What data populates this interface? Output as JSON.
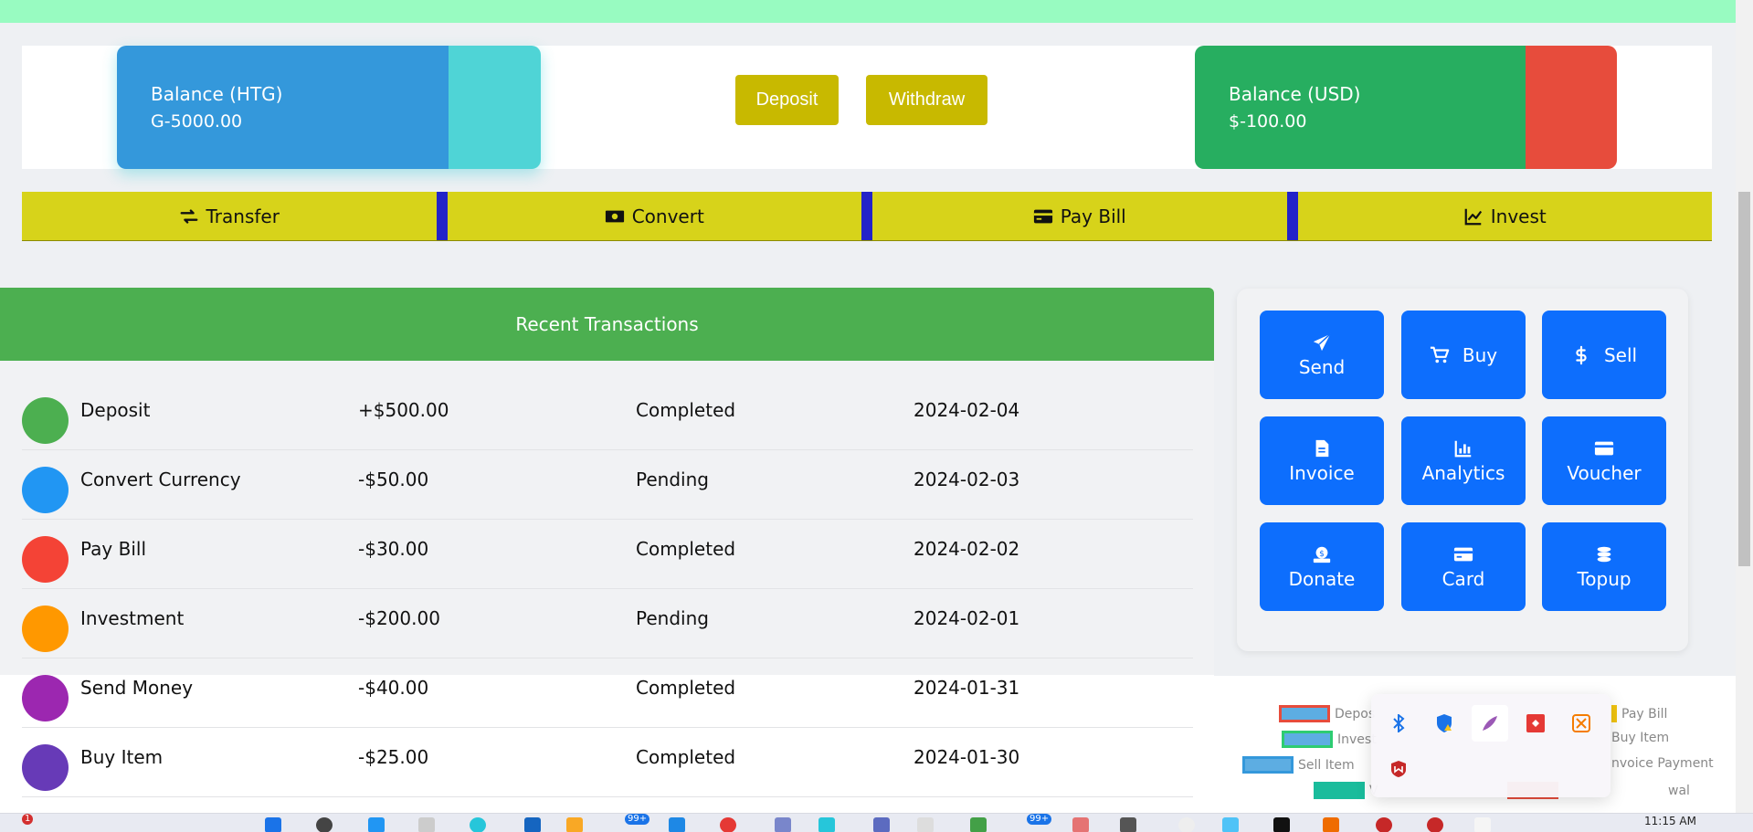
{
  "balances": {
    "htg": {
      "title": "Balance (HTG)",
      "value": "G-5000.00"
    },
    "usd": {
      "title": "Balance (USD)",
      "value": "$-100.00"
    }
  },
  "actions": {
    "deposit": "Deposit",
    "withdraw": "Withdraw"
  },
  "nav": {
    "transfer": {
      "label": "Transfer",
      "icon": "exchange-icon"
    },
    "convert": {
      "label": "Convert",
      "icon": "money-bill-icon"
    },
    "pay_bill": {
      "label": "Pay Bill",
      "icon": "credit-card-icon"
    },
    "invest": {
      "label": "Invest",
      "icon": "chart-line-icon"
    }
  },
  "transactions": {
    "header": "Recent Transactions",
    "rows": [
      {
        "name": "Deposit",
        "amount": "+$500.00",
        "status": "Completed",
        "date": "2024-02-04",
        "color": "#4caf50"
      },
      {
        "name": "Convert Currency",
        "amount": "-$50.00",
        "status": "Pending",
        "date": "2024-02-03",
        "color": "#2196f3"
      },
      {
        "name": "Pay Bill",
        "amount": "-$30.00",
        "status": "Completed",
        "date": "2024-02-02",
        "color": "#f44336"
      },
      {
        "name": "Investment",
        "amount": "-$200.00",
        "status": "Pending",
        "date": "2024-02-01",
        "color": "#ff9800"
      },
      {
        "name": "Send Money",
        "amount": "-$40.00",
        "status": "Completed",
        "date": "2024-01-31",
        "color": "#9c27b0"
      },
      {
        "name": "Buy Item",
        "amount": "-$25.00",
        "status": "Completed",
        "date": "2024-01-30",
        "color": "#673ab7"
      }
    ]
  },
  "quick_actions": [
    {
      "label": "Send",
      "icon": "paper-plane-icon"
    },
    {
      "label": "Buy",
      "icon": "cart-icon"
    },
    {
      "label": "Sell",
      "icon": "dollar-icon"
    },
    {
      "label": "Invoice",
      "icon": "file-icon"
    },
    {
      "label": "Analytics",
      "icon": "bar-chart-icon"
    },
    {
      "label": "Voucher",
      "icon": "card-icon"
    },
    {
      "label": "Donate",
      "icon": "donate-icon"
    },
    {
      "label": "Card",
      "icon": "credit-card-icon"
    },
    {
      "label": "Topup",
      "icon": "coins-icon"
    }
  ],
  "chart_legend": [
    {
      "label": "Depos",
      "color": "#e74c3c"
    },
    {
      "label": "Invest",
      "color": "#2ecc71"
    },
    {
      "label": "Sell Item",
      "color": "#3498db"
    },
    {
      "label": "Pay Bill",
      "color": "#f1c40f"
    },
    {
      "label": "Buy Item",
      "color": "#9b59b6"
    },
    {
      "label": "nvoice Payment",
      "color": "#e67e22"
    },
    {
      "label": "V",
      "color": "#1abc9c"
    },
    {
      "label": "wal",
      "color": "#e74c3c"
    }
  ],
  "taskbar": {
    "clock": "11:15 AM",
    "notification_count": "1",
    "badge_a": "99+",
    "badge_b": "99+"
  }
}
